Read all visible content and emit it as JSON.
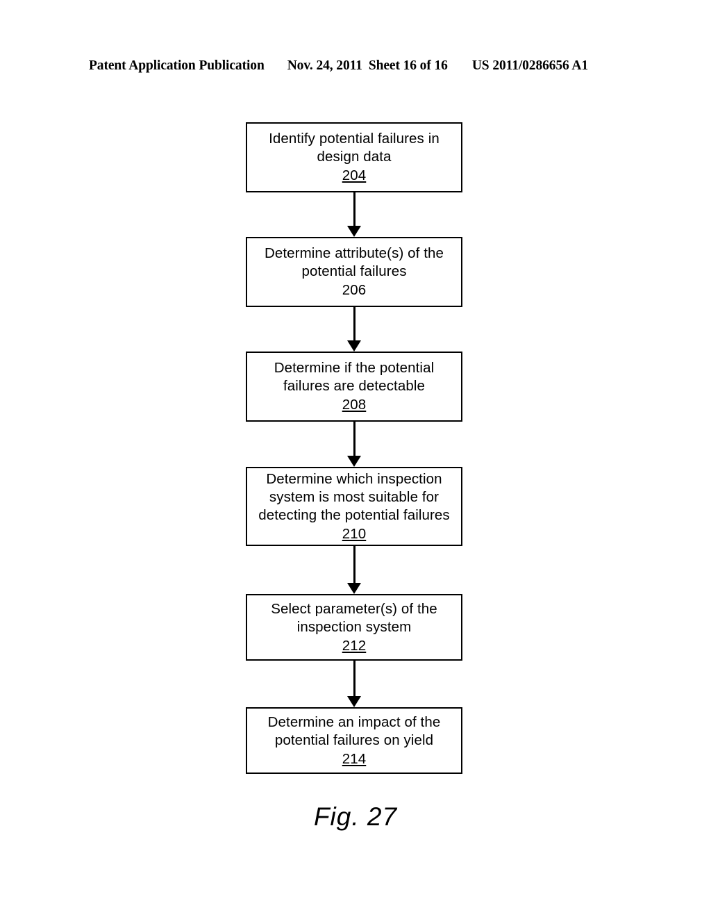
{
  "header": {
    "publication": "Patent Application Publication",
    "date": "Nov. 24, 2011",
    "sheet": "Sheet 16 of 16",
    "patent_number": "US 2011/0286656 A1"
  },
  "figure": {
    "caption": "Fig. 27"
  },
  "flowchart": {
    "type": "flowchart",
    "orientation": "vertical",
    "nodes": [
      {
        "id": "204",
        "text": "Identify potential failures in\ndesign data",
        "ref": "204",
        "ref_underlined": true
      },
      {
        "id": "206",
        "text": "Determine attribute(s) of the\npotential failures",
        "ref": "206",
        "ref_underlined": false
      },
      {
        "id": "208",
        "text": "Determine if the potential\nfailures are detectable",
        "ref": "208",
        "ref_underlined": true
      },
      {
        "id": "210",
        "text": "Determine which inspection\nsystem is most suitable for\ndetecting the potential failures",
        "ref": "210",
        "ref_underlined": true
      },
      {
        "id": "212",
        "text": "Select parameter(s) of the\ninspection system",
        "ref": "212",
        "ref_underlined": true
      },
      {
        "id": "214",
        "text": "Determine an impact of the\npotential failures on yield",
        "ref": "214",
        "ref_underlined": true
      }
    ],
    "edges": [
      {
        "from": "204",
        "to": "206",
        "style": "arrow"
      },
      {
        "from": "206",
        "to": "208",
        "style": "arrow"
      },
      {
        "from": "208",
        "to": "210",
        "style": "arrow"
      },
      {
        "from": "210",
        "to": "212",
        "style": "arrow"
      },
      {
        "from": "212",
        "to": "214",
        "style": "arrow"
      }
    ]
  },
  "colors": {
    "ink": "#000000",
    "paper": "#ffffff"
  }
}
